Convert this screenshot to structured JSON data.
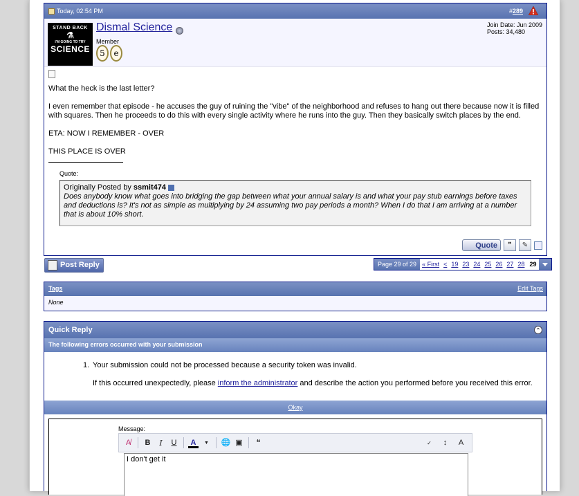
{
  "post": {
    "date": "Today, 02:54 PM",
    "hash": "#",
    "number": "289",
    "username": "Dismal Science",
    "user_title": "Member",
    "join_date": "Join Date: Jun 2009",
    "posts": "Posts: 34,480",
    "avatar": {
      "line1": "STAND BACK",
      "line2": "I'M GOING TO TRY",
      "line3": "SCIENCE"
    },
    "badges": [
      "5",
      "e"
    ],
    "body": [
      "What the heck is the last letter?",
      "I even remember that episode - he accuses the guy of ruining the \"vibe\" of the neighborhood and refuses to hang out there because now it is filled with squares. Then he proceeds to do this with every single activity where he runs into the guy. Then they basically switch places by the end.",
      "ETA: NOW I REMEMBER - OVER",
      "THIS PLACE IS OVER"
    ],
    "quote": {
      "label": "Quote:",
      "posted_by_prefix": "Originally Posted by",
      "author": "ssmit474",
      "text": "Does anybody know what goes into bridging the gap between what your annual salary is and what your pay stub earnings before taxes and deductions is? It's not as simple as multiplying by 24 assuming two pay periods a month? When I do that I am arriving at a number that is about 10% short."
    },
    "quote_button": "Quote"
  },
  "post_reply": "Post Reply",
  "pagenav": {
    "label": "Page 29 of 29",
    "first": "« First",
    "prev": "<",
    "pages": [
      "19",
      "23",
      "24",
      "25",
      "26",
      "27",
      "28"
    ],
    "current": "29"
  },
  "tags": {
    "title": "Tags",
    "edit": "Edit Tags",
    "value": "None"
  },
  "quick_reply": {
    "title": "Quick Reply",
    "errors_header": "The following errors occurred with your submission",
    "error_number": "1.",
    "error_text": "Your submission could not be processed because a security token was invalid.",
    "error_help_pre": "If this occurred unexpectedly, please",
    "error_help_link": "inform the administrator",
    "error_help_post": "and describe the action you performed before you received this error.",
    "okay": "Okay",
    "message_label": "Message:",
    "message_value": "I don't get it"
  },
  "colors": {
    "header_bg": "#5873b0",
    "border": "#0b198c",
    "link": "#22229c"
  }
}
